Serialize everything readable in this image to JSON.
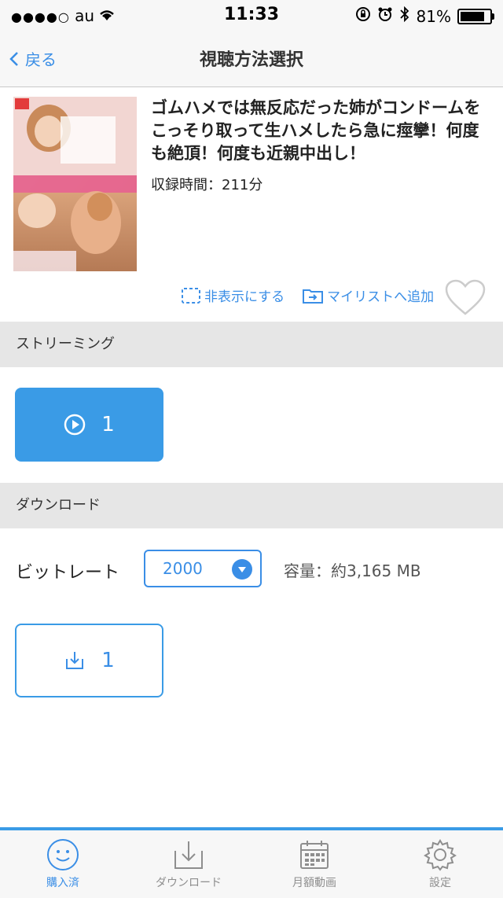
{
  "status": {
    "carrier": "au",
    "time": "11:33",
    "battery": "81%",
    "battery_level": 0.81
  },
  "nav": {
    "back_label": "戻る",
    "title": "視聴方法選択"
  },
  "product": {
    "title": "ゴムハメでは無反応だった姉がコンドームをこっそり取って生ハメしたら急に痙攣！何度も絶頂！何度も近親中出し！",
    "duration": "収録時間：211分",
    "hide_label": "非表示にする",
    "mylist_label": "マイリストへ追加"
  },
  "streaming": {
    "header": "ストリーミング",
    "button_label": "1"
  },
  "download": {
    "header": "ダウンロード",
    "bitrate_label": "ビットレート",
    "bitrate_value": "2000",
    "capacity": "容量：約3,165 MB",
    "button_label": "1"
  },
  "tabs": [
    {
      "label": "購入済",
      "icon": "smile-icon",
      "active": true
    },
    {
      "label": "ダウンロード",
      "icon": "download-tray-icon",
      "active": false
    },
    {
      "label": "月額動画",
      "icon": "calendar-icon",
      "active": false
    },
    {
      "label": "設定",
      "icon": "gear-icon",
      "active": false
    }
  ],
  "colors": {
    "accent": "#3a9be6",
    "section_bg": "#e6e6e6"
  }
}
